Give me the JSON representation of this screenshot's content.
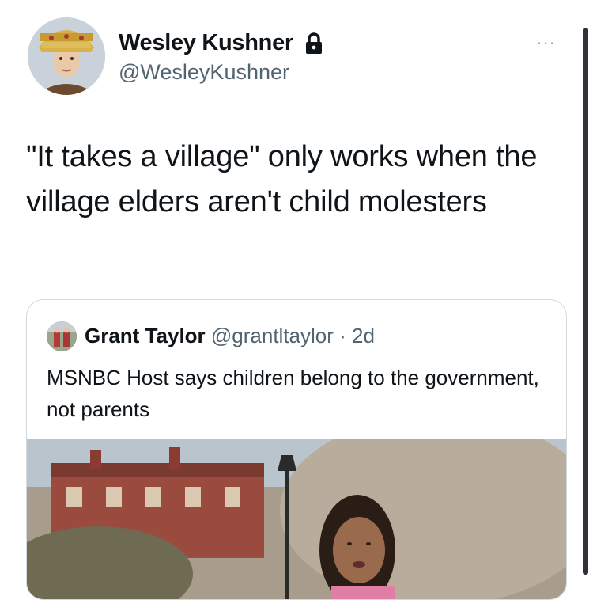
{
  "tweet": {
    "display_name": "Wesley Kushner",
    "handle": "@WesleyKushner",
    "text": "\"It takes a village\" only works when the village elders aren't child molesters",
    "verified_icon": "lock-icon",
    "more_icon": "more-options-icon",
    "more_label": "···"
  },
  "quoted_tweet": {
    "display_name": "Grant Taylor",
    "handle": "@grantltaylor",
    "separator": " · ",
    "time": "2d",
    "text": "MSNBC Host says children belong to the government, not parents"
  },
  "colors": {
    "text": "#0f1419",
    "secondary": "#536471",
    "border": "#cfd9de",
    "background": "#ffffff"
  }
}
